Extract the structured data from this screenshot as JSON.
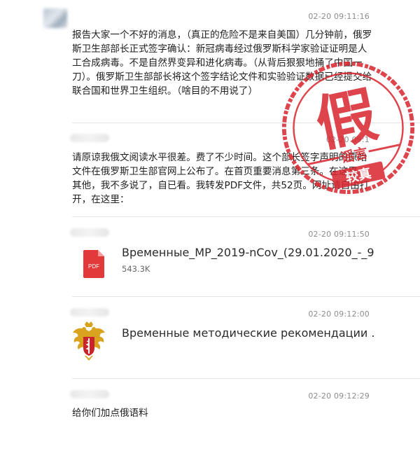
{
  "messages": [
    {
      "time": "02-20 09:11:16",
      "text": "报告大家一个不好的消息，（真正的危险不是来自美国）几分钟前，俄罗斯卫生部部长正式签字确认：新冠病毒经过俄罗斯科学家验证证明是人工合成病毒。不是自然界变异和进化病毒。（从背后狠狠地捅了中国一刀）。俄罗斯卫生部部长将这个签字结论文件和实验验证数据已经提交给联合国和世界卫生组织。（啥目的不用说了）"
    },
    {
      "time": "02-20 09:1",
      "text": "请原谅我俄文阅读水平很差。费了不少时间。这个部长签字声明的原始文件在俄罗斯卫生部官网上公布了。在首页重要消息第三条。在这里。其他，我不多说了，自已看。我转发PDF文件，共52页。网址请自由打开，在这里："
    },
    {
      "time": "02-20 09:11:50",
      "file_name": "Временные_MP_2019-nCov_(29.01.2020_-_9...",
      "file_size": "543.3K",
      "icon_label": "PDF"
    },
    {
      "time": "02-20 09:12:00",
      "link_title": "Временные методические рекомендации ..."
    },
    {
      "time": "02-20 09:12:29",
      "text": "给你们加点俄语料"
    }
  ],
  "stamp": {
    "main_char": "假",
    "ring_text": "谣言",
    "bottom_text": "较真"
  },
  "colors": {
    "stamp_red": "#d8262f",
    "pdf_red": "#e2393a"
  }
}
